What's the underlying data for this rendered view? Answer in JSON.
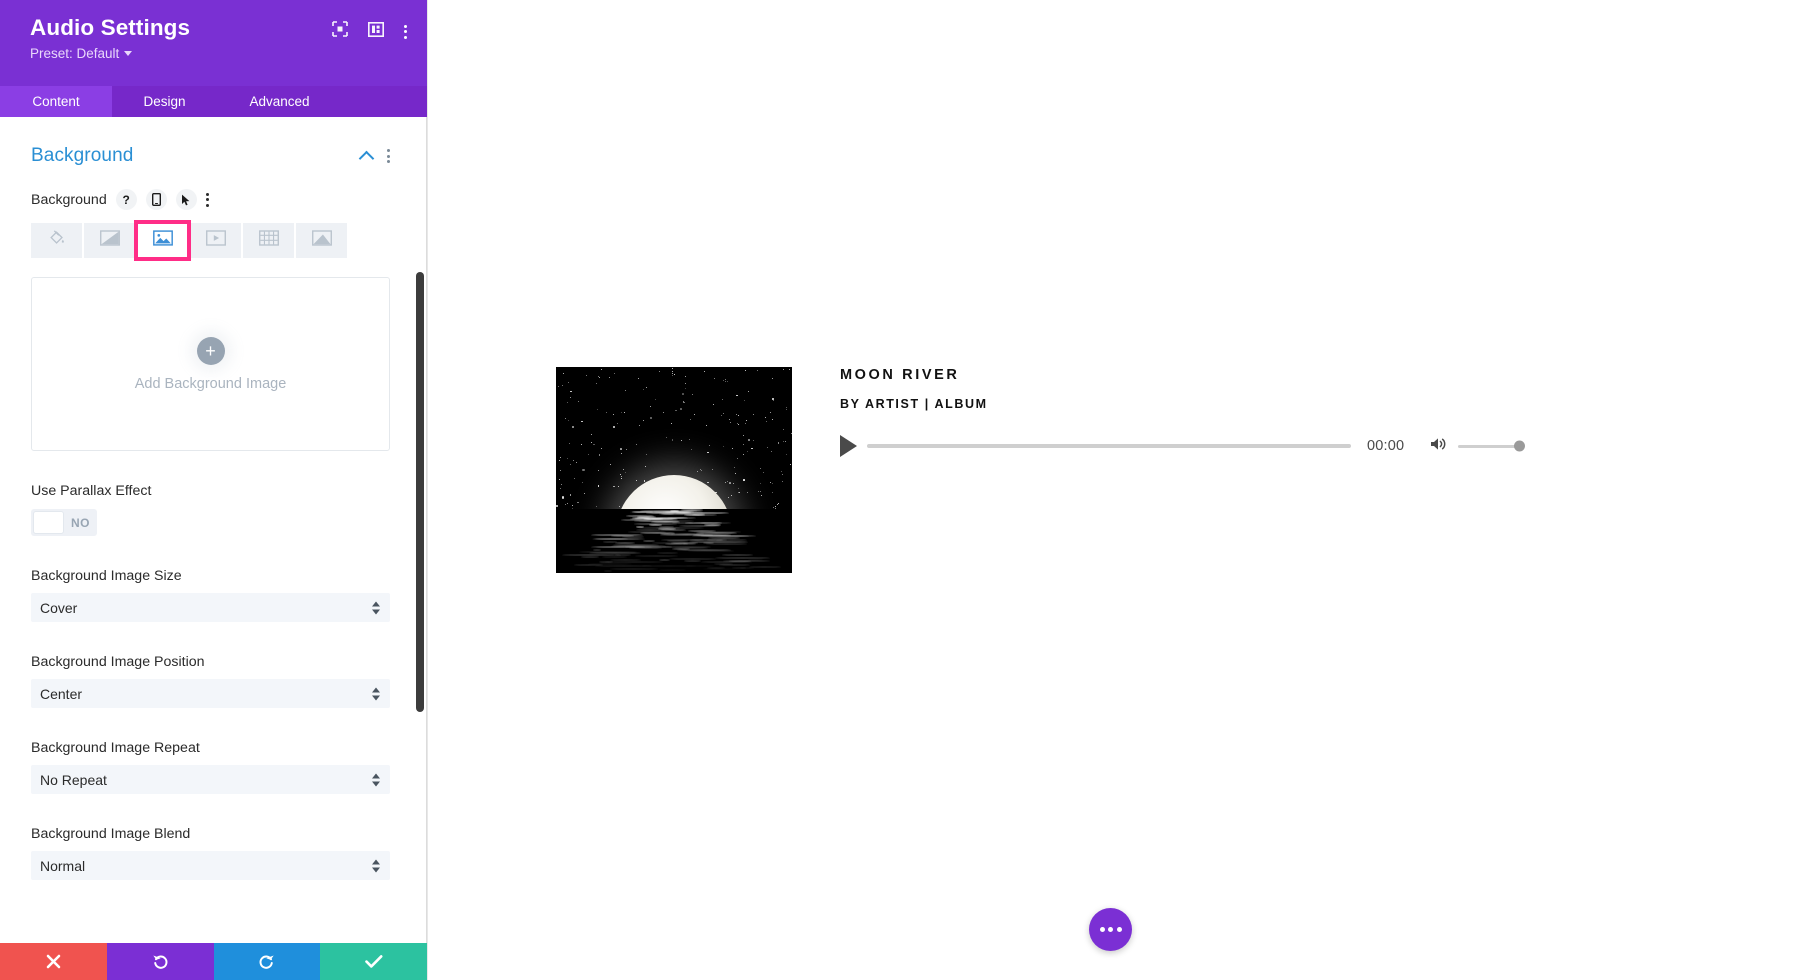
{
  "panel": {
    "title": "Audio Settings",
    "preset_label": "Preset: Default",
    "header_icons": [
      {
        "name": "focus-target-icon"
      },
      {
        "name": "layout-columns-icon"
      },
      {
        "name": "kebab-menu-icon"
      }
    ],
    "tabs": [
      {
        "label": "Content",
        "active": true
      },
      {
        "label": "Design",
        "active": false
      },
      {
        "label": "Advanced",
        "active": false
      }
    ],
    "section": {
      "title": "Background",
      "collapse_icon": "chevron-up-icon",
      "options_icon": "kebab-menu-icon"
    },
    "background_field": {
      "label": "Background",
      "help_icon": "question-mark-icon",
      "responsive_icon": "mobile-device-icon",
      "hover_icon": "cursor-pointer-icon",
      "options_icon": "kebab-menu-icon",
      "types": [
        {
          "name": "background-color",
          "icon": "paint-bucket-icon",
          "selected": false
        },
        {
          "name": "background-gradient",
          "icon": "gradient-icon",
          "selected": false
        },
        {
          "name": "background-image",
          "icon": "image-icon",
          "selected": true
        },
        {
          "name": "background-video",
          "icon": "video-play-icon",
          "selected": false
        },
        {
          "name": "background-pattern",
          "icon": "pattern-grid-icon",
          "selected": false
        },
        {
          "name": "background-mask",
          "icon": "mask-shape-icon",
          "selected": false
        }
      ],
      "selected_highlight_color": "#ff2d87"
    },
    "upload": {
      "label": "Add Background Image",
      "plus_icon": "plus-icon"
    },
    "parallax": {
      "label": "Use Parallax Effect",
      "value": "NO"
    },
    "fields": [
      {
        "label": "Background Image Size",
        "value": "Cover"
      },
      {
        "label": "Background Image Position",
        "value": "Center"
      },
      {
        "label": "Background Image Repeat",
        "value": "No Repeat"
      },
      {
        "label": "Background Image Blend",
        "value": "Normal"
      }
    ],
    "actions": [
      {
        "name": "cancel",
        "icon": "close-x-icon",
        "color": "#f0534f"
      },
      {
        "name": "undo",
        "icon": "undo-arrow-icon",
        "color": "#7b2fd4"
      },
      {
        "name": "redo",
        "icon": "redo-arrow-icon",
        "color": "#1f8fdc"
      },
      {
        "name": "save",
        "icon": "checkmark-icon",
        "color": "#2cc2a0"
      }
    ]
  },
  "canvas": {
    "audio_module": {
      "artwork_alt": "moon over water album art",
      "title": "MOON RIVER",
      "subtitle": "BY ARTIST | ALBUM",
      "play_icon": "play-triangle-icon",
      "current_time": "00:00",
      "volume_icon": "speaker-volume-icon",
      "progress_percent": 0,
      "volume_percent": 100
    },
    "fab": {
      "name": "more-options-fab",
      "icon": "ellipsis-icon"
    }
  }
}
